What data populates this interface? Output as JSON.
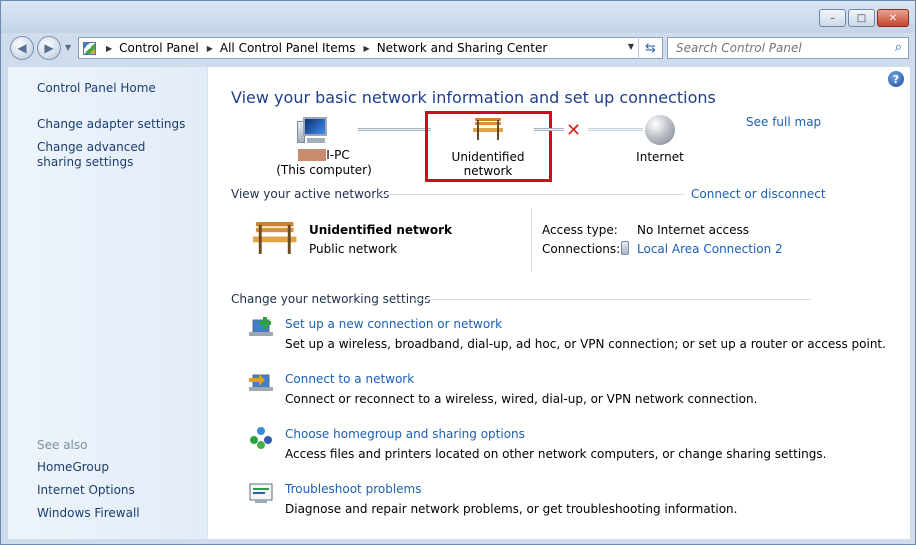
{
  "window": {
    "buttons": {
      "minimize": "–",
      "maximize": "□",
      "close": "✕"
    }
  },
  "nav": {
    "back_icon": "arrow-left-icon",
    "forward_icon": "arrow-right-icon",
    "breadcrumb": [
      "Control Panel",
      "All Control Panel Items",
      "Network and Sharing Center"
    ],
    "search_placeholder": "Search Control Panel"
  },
  "sidebar": {
    "items": [
      {
        "label": "Control Panel Home"
      },
      {
        "label": "Change adapter settings"
      },
      {
        "label": "Change advanced sharing settings"
      }
    ],
    "see_also_label": "See also",
    "see_also": [
      {
        "label": "HomeGroup"
      },
      {
        "label": "Internet Options"
      },
      {
        "label": "Windows Firewall"
      }
    ]
  },
  "main": {
    "heading": "View your basic network information and set up connections",
    "see_full_map": "See full map",
    "map": {
      "computer_name_suffix": "I-PC",
      "computer_sub": "(This computer)",
      "network_label": "Unidentified network",
      "internet_label": "Internet"
    },
    "active_networks": {
      "section_title": "View your active networks",
      "connect_link": "Connect or disconnect",
      "name": "Unidentified network",
      "type": "Public network",
      "access_type_label": "Access type:",
      "access_type_value": "No Internet access",
      "connections_label": "Connections:",
      "connections_value": "Local Area Connection 2"
    },
    "settings": {
      "section_title": "Change your networking settings",
      "tasks": [
        {
          "link": "Set up a new connection or network",
          "desc": "Set up a wireless, broadband, dial-up, ad hoc, or VPN connection; or set up a router or access point."
        },
        {
          "link": "Connect to a network",
          "desc": "Connect or reconnect to a wireless, wired, dial-up, or VPN network connection."
        },
        {
          "link": "Choose homegroup and sharing options",
          "desc": "Access files and printers located on other network computers, or change sharing settings."
        },
        {
          "link": "Troubleshoot problems",
          "desc": "Diagnose and repair network problems, or get troubleshooting information."
        }
      ]
    }
  },
  "colors": {
    "link": "#1a5fb4",
    "heading": "#1e3e8a",
    "highlight": "#d00b1b",
    "disconnected": "#d42a1d"
  }
}
